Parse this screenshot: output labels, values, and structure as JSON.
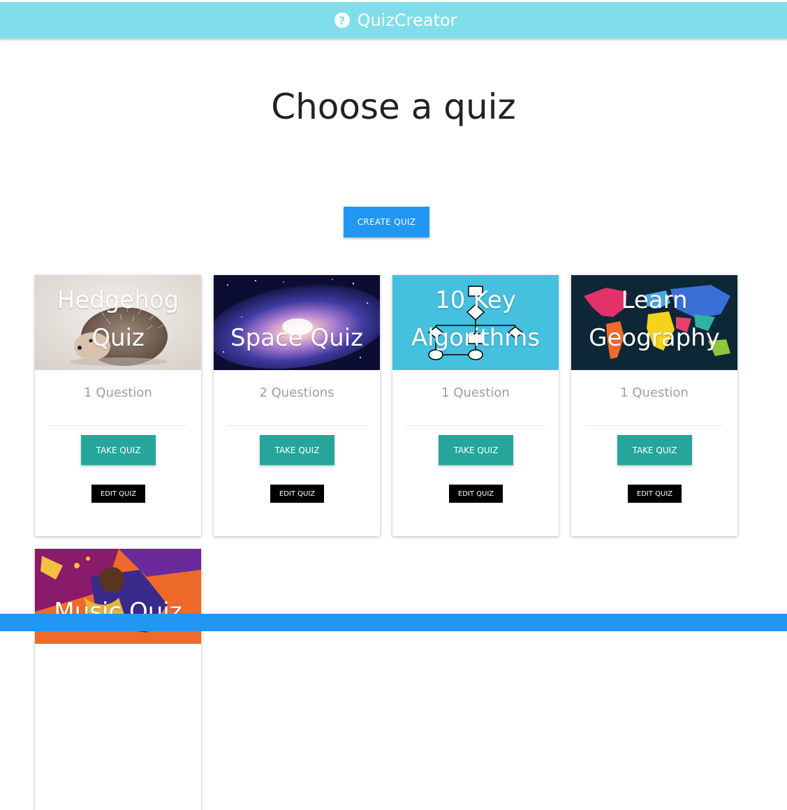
{
  "header": {
    "brand": "QuizCreator",
    "icon": "question-circle-icon",
    "color": "#80deea"
  },
  "main": {
    "title": "Choose a quiz",
    "create_label": "CREATE QUIZ"
  },
  "cards": [
    {
      "title": "Hedgehog Quiz",
      "title_lines": [
        "Hedgehog",
        "Quiz"
      ],
      "count": "1 Question",
      "take": "TAKE QUIZ",
      "edit": "EDIT QUIZ"
    },
    {
      "title": "Space Quiz",
      "title_lines": [
        "Space Quiz"
      ],
      "count": "2 Questions",
      "take": "TAKE QUIZ",
      "edit": "EDIT QUIZ"
    },
    {
      "title": "10 Key Algorithms",
      "title_lines": [
        "10 Key",
        "Algorithms"
      ],
      "count": "1 Question",
      "take": "TAKE QUIZ",
      "edit": "EDIT QUIZ"
    },
    {
      "title": "Learn Geography",
      "title_lines": [
        "Learn",
        "Geography"
      ],
      "count": "1 Question",
      "take": "TAKE QUIZ",
      "edit": "EDIT QUIZ"
    },
    {
      "title": "Music Quiz",
      "title_lines": [
        "Music Quiz"
      ]
    }
  ],
  "colors": {
    "create_button": "#2196f3",
    "take_button": "#26a69a",
    "edit_button": "#000000",
    "footer": "#2196f3"
  }
}
